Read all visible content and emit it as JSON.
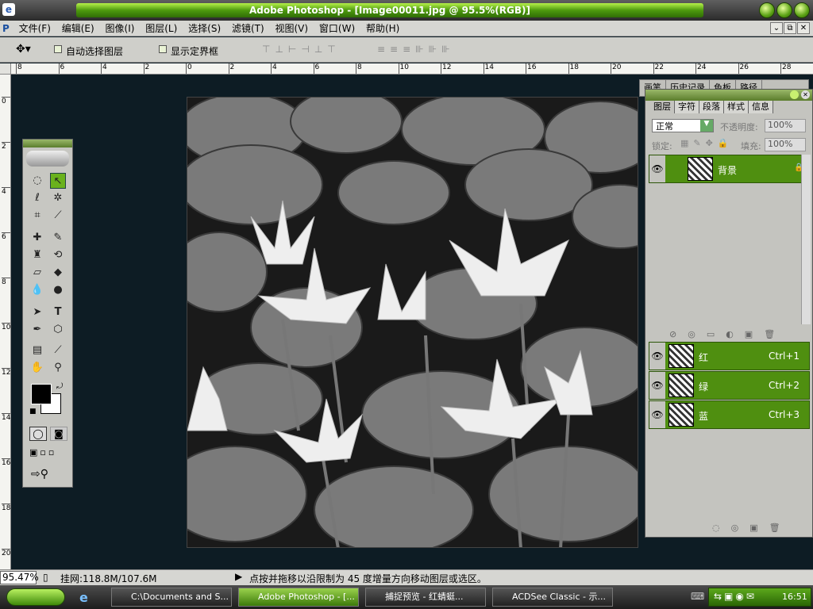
{
  "window": {
    "title": "Adobe Photoshop - [Image00011.jpg @ 95.5%(RGB)]"
  },
  "menu": [
    "文件(F)",
    "编辑(E)",
    "图像(I)",
    "图层(L)",
    "选择(S)",
    "滤镜(T)",
    "视图(V)",
    "窗口(W)",
    "帮助(H)"
  ],
  "options": {
    "auto_select": "自动选择图层",
    "show_bounds": "显示定界框"
  },
  "palette_well": [
    "画笔",
    "历史记录",
    "色板",
    "路径"
  ],
  "ruler_h": [
    "8",
    "6",
    "4",
    "2",
    "0",
    "2",
    "4",
    "6",
    "8",
    "10",
    "12",
    "14",
    "16",
    "18",
    "20",
    "22",
    "24",
    "26",
    "28"
  ],
  "ruler_v": [
    "0",
    "2",
    "4",
    "6",
    "8",
    "10",
    "12",
    "14",
    "16",
    "18",
    "20"
  ],
  "layers_panel": {
    "tabs": [
      "图层",
      "字符",
      "段落",
      "样式",
      "信息"
    ],
    "blend_mode": "正常",
    "opacity_label": "不透明度:",
    "opacity_value": "100%",
    "lock_label": "锁定:",
    "fill_label": "填充:",
    "fill_value": "100%",
    "background_layer": "背景",
    "channels": [
      {
        "name": "红",
        "shortcut": "Ctrl+1"
      },
      {
        "name": "绿",
        "shortcut": "Ctrl+2"
      },
      {
        "name": "蓝",
        "shortcut": "Ctrl+3"
      }
    ]
  },
  "status": {
    "zoom": "95.47%",
    "doc": "挂网:118.8M/107.6M",
    "hint": "点按并拖移以沿限制为 45 度增量方向移动图层或选区。"
  },
  "taskbar": {
    "tasks": [
      "C:\\Documents and S...",
      "Adobe Photoshop - [...",
      "捕捉预览 - 红蜻蜓...",
      "ACDSee Classic - 示..."
    ],
    "clock": "16:51"
  },
  "colors": {
    "accent": "#4f8f10",
    "canvas_bg": "#0d1c24"
  }
}
